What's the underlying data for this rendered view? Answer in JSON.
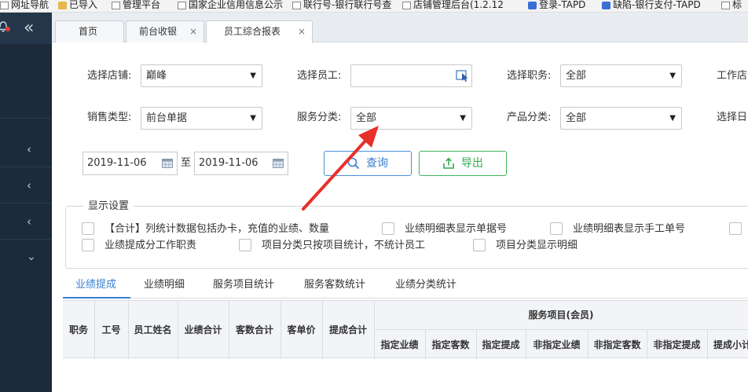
{
  "bookmarks": [
    {
      "label": "网址导航",
      "icon": "page-icon"
    },
    {
      "label": "已导入",
      "icon": "folder-icon"
    },
    {
      "label": "管理平台",
      "icon": "page-icon"
    },
    {
      "label": "国家企业信用信息公示",
      "icon": "page-icon"
    },
    {
      "label": "联行号-银行联行号查",
      "icon": "page-icon"
    },
    {
      "label": "店铺管理后台(1.2.12",
      "icon": "page-icon"
    },
    {
      "label": "登录-TAPD",
      "icon": "tapd-icon"
    },
    {
      "label": "缺陷-银行支付-TAPD",
      "icon": "tapd-icon"
    },
    {
      "label": "标",
      "icon": "page-icon"
    }
  ],
  "sidebar": {
    "collapse_glyph": "«",
    "arrows": [
      "‹",
      "‹",
      "‹",
      "⌄"
    ]
  },
  "tabs": [
    {
      "label": "首页",
      "closable": false
    },
    {
      "label": "前台收银",
      "closable": true,
      "close": "×"
    },
    {
      "label": "员工综合报表",
      "closable": true,
      "close": "×",
      "active": true
    }
  ],
  "filters": {
    "store": {
      "label": "选择店铺:",
      "value": "巅峰"
    },
    "employee": {
      "label": "选择员工:",
      "value": ""
    },
    "position": {
      "label": "选择职务:",
      "value": "全部"
    },
    "work_store": {
      "label": "工作店"
    },
    "sales_type": {
      "label": "销售类型:",
      "value": "前台单据"
    },
    "service_category": {
      "label": "服务分类:",
      "value": "全部"
    },
    "product_category": {
      "label": "产品分类:",
      "value": "全部"
    },
    "select_date": {
      "label": "选择日"
    },
    "date_from": "2019-11-06",
    "date_sep": "至",
    "date_to": "2019-11-06",
    "caret": "▼"
  },
  "buttons": {
    "query": "查询",
    "export": "导出"
  },
  "display_settings": {
    "title": "显示设置",
    "options": [
      "【合计】列统计数据包括办卡，充值的业绩、数量",
      "业绩明细表显示单据号",
      "业绩明细表显示手工单号",
      "业绩提成分工作职责",
      "项目分类只按项目统计，不统计员工",
      "项目分类显示明细"
    ]
  },
  "report_tabs": [
    "业绩提成",
    "业绩明细",
    "服务项目统计",
    "服务客数统计",
    "业绩分类统计"
  ],
  "table": {
    "columns": [
      "职务",
      "工号",
      "员工姓名",
      "业绩合计",
      "客数合计",
      "客单价",
      "提成合计"
    ],
    "group_header": "服务项目(会员)",
    "sub_columns": [
      "指定业绩",
      "指定客数",
      "指定提成",
      "非指定业绩",
      "非指定客数",
      "非指定提成",
      "提成小计"
    ]
  },
  "colors": {
    "accent_blue": "#3a7fd0",
    "accent_green": "#33a84f",
    "sidebar": "#1c2a39",
    "annotation_red": "#e8302a"
  }
}
